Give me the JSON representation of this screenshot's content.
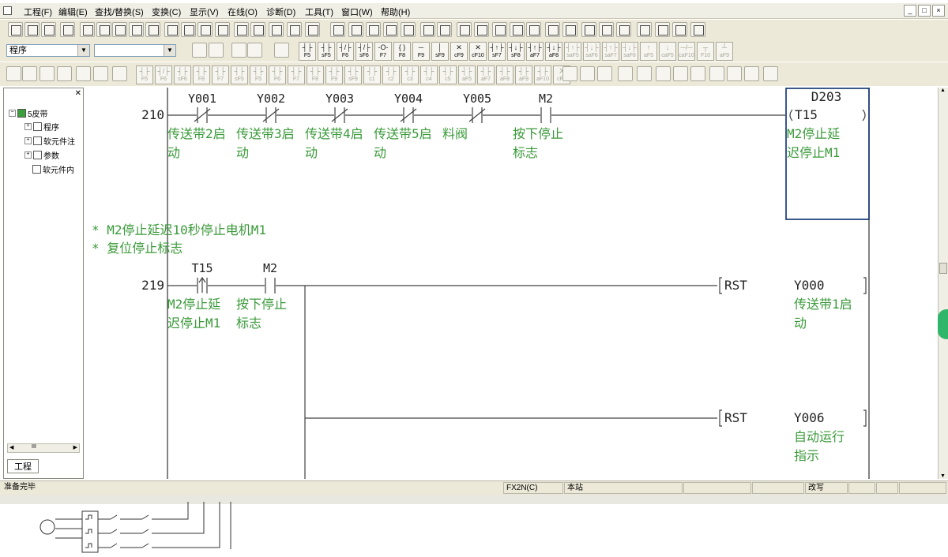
{
  "menu": {
    "items": [
      "工程(F)",
      "编辑(E)",
      "查找/替换(S)",
      "变换(C)",
      "显示(V)",
      "在线(O)",
      "诊断(D)",
      "工具(T)",
      "窗口(W)",
      "帮助(H)"
    ]
  },
  "window_controls": [
    "_",
    "□",
    "×"
  ],
  "toolbar": {
    "mode_combo": "程序",
    "second_combo": "",
    "fkeys_row1": [
      {
        "sym": "┤├",
        "lab": "F5"
      },
      {
        "sym": "┤├",
        "lab": "sF5"
      },
      {
        "sym": "┤/├",
        "lab": "F6"
      },
      {
        "sym": "┤/├",
        "lab": "sF6"
      },
      {
        "sym": "-O-",
        "lab": "F7"
      },
      {
        "sym": "{ }",
        "lab": "F8"
      },
      {
        "sym": "─",
        "lab": "F9"
      },
      {
        "sym": "│",
        "lab": "sF9"
      },
      {
        "sym": "✕",
        "lab": "cF9"
      },
      {
        "sym": "✕",
        "lab": "cF10"
      },
      {
        "sym": "┤↑├",
        "lab": "sF7"
      },
      {
        "sym": "┤↓├",
        "lab": "sF8"
      },
      {
        "sym": "┤↑├",
        "lab": "aF7"
      },
      {
        "sym": "┤↓├",
        "lab": "aF8"
      },
      {
        "sym": "┤↑├",
        "lab": "saF5"
      },
      {
        "sym": "┤↓├",
        "lab": "saF6"
      },
      {
        "sym": "┤↑├",
        "lab": "saF7"
      },
      {
        "sym": "┤↓├",
        "lab": "saF8"
      },
      {
        "sym": "↑",
        "lab": "aF5"
      },
      {
        "sym": "↓",
        "lab": "caF5"
      },
      {
        "sym": "─/─",
        "lab": "caF10"
      },
      {
        "sym": "┬",
        "lab": "F10"
      },
      {
        "sym": "┴",
        "lab": "aF9"
      }
    ],
    "fkeys_row2": [
      {
        "sym": "┤├",
        "lab": "F5"
      },
      {
        "sym": "┤/├",
        "lab": "F6"
      },
      {
        "sym": "┤├",
        "lab": "sF6"
      },
      {
        "sym": "┤├",
        "lab": "F8"
      },
      {
        "sym": "┤├",
        "lab": "F7"
      },
      {
        "sym": "┤├",
        "lab": "sF5"
      },
      {
        "sym": "┤├",
        "lab": "F5"
      },
      {
        "sym": "┤├",
        "lab": "F6"
      },
      {
        "sym": "┤├",
        "lab": "F7"
      },
      {
        "sym": "┤├",
        "lab": "F8"
      },
      {
        "sym": "┤├",
        "lab": "F9"
      },
      {
        "sym": "┤├",
        "lab": "sF9"
      },
      {
        "sym": "┤├",
        "lab": "c1"
      },
      {
        "sym": "┤├",
        "lab": "c2"
      },
      {
        "sym": "┤├",
        "lab": "c3"
      },
      {
        "sym": "┤├",
        "lab": "c4"
      },
      {
        "sym": "┤├",
        "lab": "c5"
      },
      {
        "sym": "┤├",
        "lab": "aF5"
      },
      {
        "sym": "┤├",
        "lab": "aF7"
      },
      {
        "sym": "┤├",
        "lab": "aF8"
      },
      {
        "sym": "┤├",
        "lab": "aF9"
      },
      {
        "sym": "┤├",
        "lab": "aF10"
      },
      {
        "sym": "X",
        "lab": "cF9"
      }
    ]
  },
  "project_tree": {
    "root": "5皮带",
    "items": [
      "程序",
      "软元件注",
      "参数",
      "软元件内"
    ],
    "tab": "工程",
    "scroll_label": "III"
  },
  "ladder": {
    "rungs": [
      {
        "step": "210",
        "contacts": [
          {
            "device": "Y001",
            "type": "NC",
            "comment": [
              "传送带2启",
              "动"
            ]
          },
          {
            "device": "Y002",
            "type": "NC",
            "comment": [
              "传送带3启",
              "动"
            ]
          },
          {
            "device": "Y003",
            "type": "NC",
            "comment": [
              "传送带4启",
              "动"
            ]
          },
          {
            "device": "Y004",
            "type": "NC",
            "comment": [
              "传送带5启",
              "动"
            ]
          },
          {
            "device": "Y005",
            "type": "NC",
            "comment": [
              "料阀",
              ""
            ]
          },
          {
            "device": "M2",
            "type": "NO",
            "comment": [
              "按下停止",
              "标志"
            ]
          }
        ],
        "coil": {
          "device": "T15",
          "param": "D203",
          "comment": [
            "M2停止延",
            "迟停止M1"
          ]
        }
      },
      {
        "notes": [
          "* M2停止延迟10秒停止电机M1",
          "* 复位停止标志"
        ]
      },
      {
        "step": "219",
        "contacts": [
          {
            "device": "T15",
            "type": "PULSE",
            "comment": [
              "M2停止延",
              "迟停止M1"
            ]
          },
          {
            "device": "M2",
            "type": "NO",
            "comment": [
              "按下停止",
              "标志"
            ]
          }
        ],
        "outputs": [
          {
            "instr": "RST",
            "device": "Y000",
            "comment": [
              "传送带1启",
              "动"
            ]
          },
          {
            "instr": "RST",
            "device": "Y006",
            "comment": [
              "自动运行",
              "指示"
            ]
          }
        ]
      }
    ]
  },
  "statusbar": {
    "ready": "准备完毕",
    "plc": "FX2N(C)",
    "station": "本站",
    "mode": "改写"
  },
  "colors": {
    "comment_green": "#3a9a3a",
    "ladder_line": "#404040",
    "highlight_box": "#0a2f6e"
  }
}
